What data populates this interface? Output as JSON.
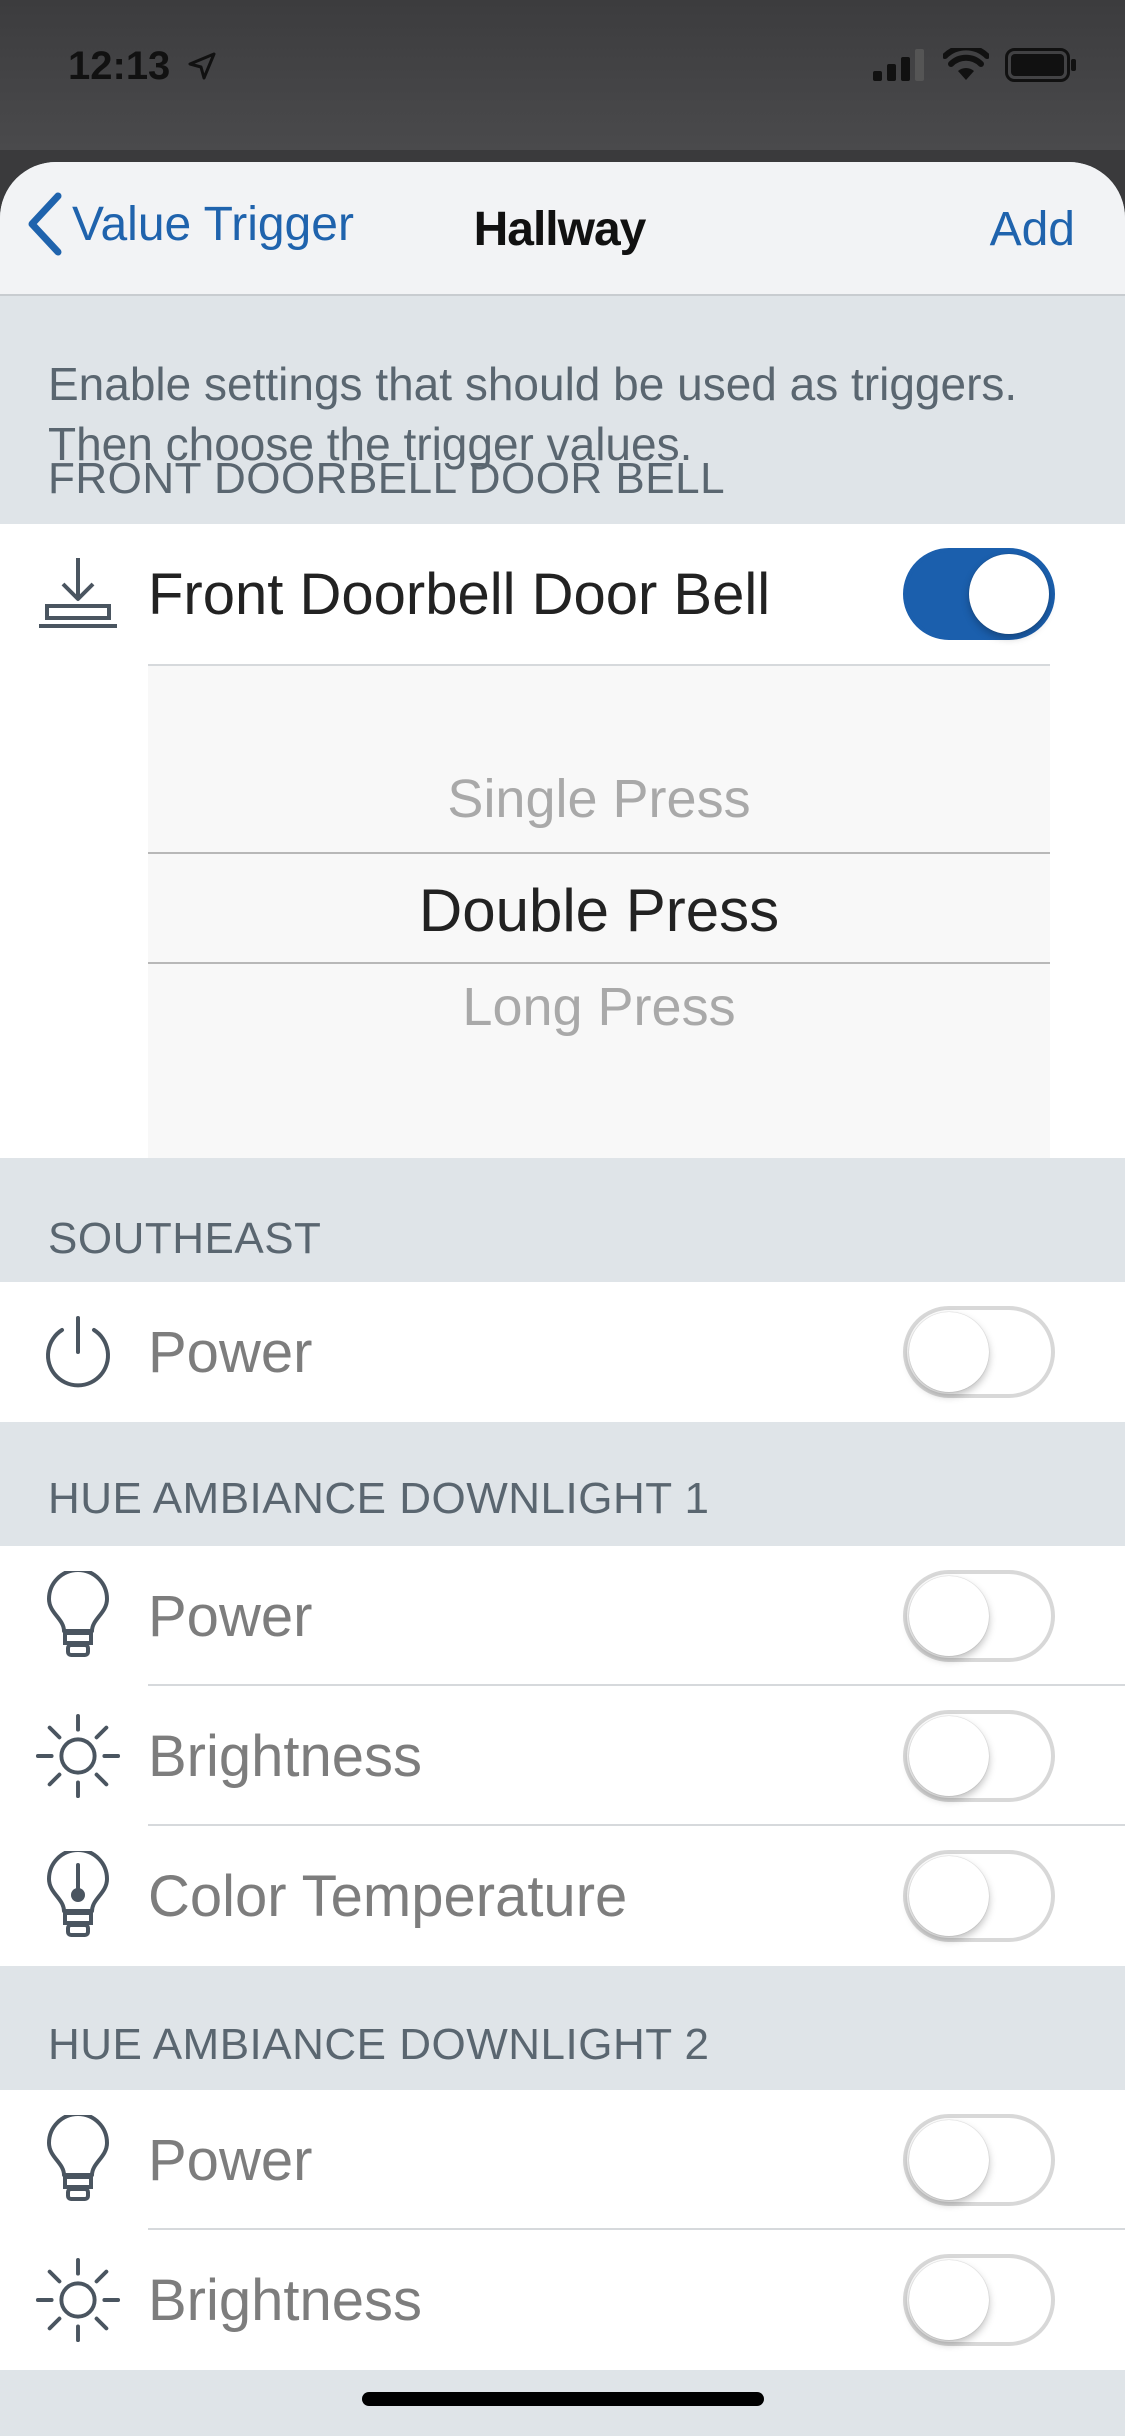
{
  "status_bar": {
    "time": "12:13"
  },
  "navbar": {
    "back_label": "Value Trigger",
    "title": "Hallway",
    "add_label": "Add"
  },
  "intro_text": "Enable settings that should be used as triggers. Then choose the trigger values.",
  "sections": {
    "doorbell": {
      "header": "FRONT DOORBELL DOOR BELL",
      "row_label": "Front Doorbell Door Bell",
      "toggle_on": true,
      "picker_options": [
        "Single Press",
        "Double Press",
        "Long Press"
      ],
      "picker_selected": "Double Press"
    },
    "southeast": {
      "header": "SOUTHEAST",
      "power_label": "Power"
    },
    "downlight1": {
      "header": "HUE AMBIANCE DOWNLIGHT 1",
      "power_label": "Power",
      "brightness_label": "Brightness",
      "color_temp_label": "Color Temperature"
    },
    "downlight2": {
      "header": "HUE AMBIANCE DOWNLIGHT 2",
      "power_label": "Power",
      "brightness_label": "Brightness"
    }
  },
  "colors": {
    "accent": "#1f63ad",
    "toggle_on": "#1b5fad",
    "section_bg": "#dfe4e8"
  }
}
